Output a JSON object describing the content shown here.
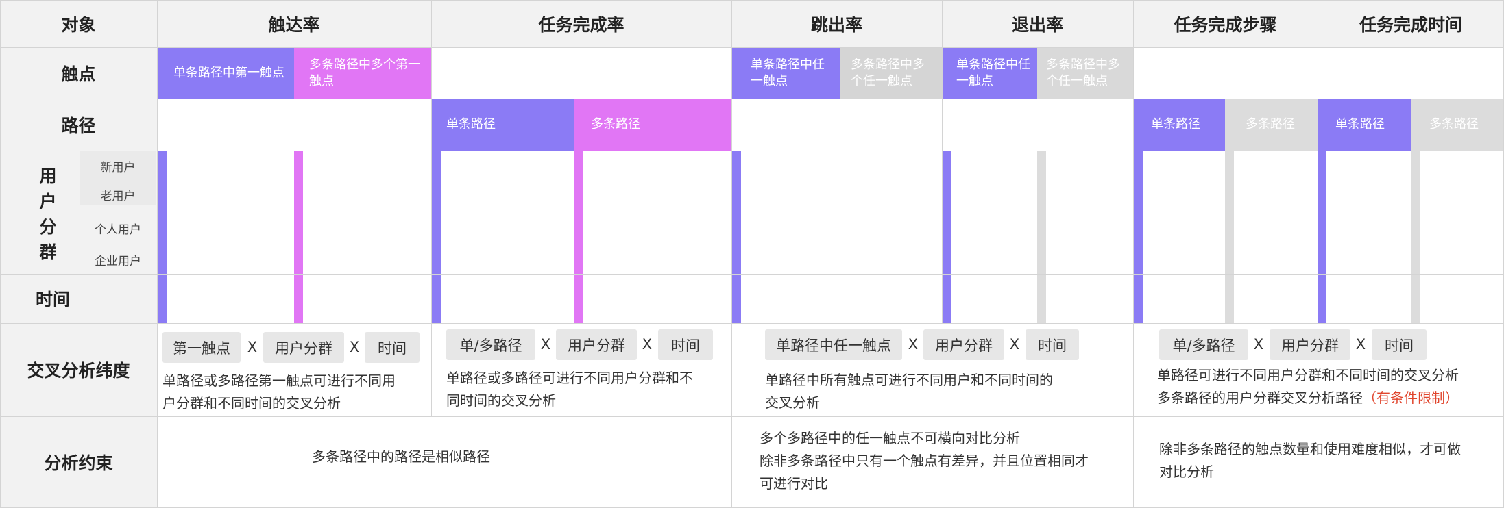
{
  "header": {
    "object": "对象",
    "cols": [
      "触达率",
      "任务完成率",
      "跳出率",
      "退出率",
      "任务完成步骤",
      "任务完成时间"
    ]
  },
  "rows": {
    "touchpoint": "触点",
    "path": "路径",
    "segment_chars": [
      "用",
      "户",
      "分",
      "群"
    ],
    "segment_subs": [
      "新用户",
      "老用户",
      "个人用户",
      "企业用户"
    ],
    "time": "时间",
    "cross": "交叉分析纬度",
    "constraint": "分析约束"
  },
  "chips": {
    "reach_single": "单条路径中第一触点",
    "reach_multi": "多条路径中多个第一触点",
    "bounce_single": "单条路径中任一触点",
    "bounce_multi": "多条路径中多个任一触点",
    "exit_single": "单条路径中任一触点",
    "exit_multi": "多条路径中多个任一触点",
    "task_single": "单条路径",
    "task_multi": "多条路径",
    "steps_single": "单条路径",
    "steps_multi": "多条路径",
    "duration_single": "单条路径",
    "duration_multi": "多条路径"
  },
  "cross": {
    "g1_tags": [
      "第一触点",
      "用户分群",
      "时间"
    ],
    "g1_text": [
      "单路径或多路径第一触点可进行不同用",
      "户分群和不同时间的交叉分析"
    ],
    "g2_tags": [
      "单/多路径",
      "用户分群",
      "时间"
    ],
    "g2_text": [
      "单路径或多路径可进行不同用户分群和不",
      "同时间的交叉分析"
    ],
    "g3_tags": [
      "单路径中任一触点",
      "用户分群",
      "时间"
    ],
    "g3_text": [
      "单路径中所有触点可进行不同用户和不同时间的",
      "交叉分析"
    ],
    "g4_tags": [
      "单/多路径",
      "用户分群",
      "时间"
    ],
    "g4_line1": "单路径可进行不同用户分群和不同时间的交叉分析",
    "g4_line2": "多条路径的用户分群交叉分析路径",
    "g4_line2_red": "（有条件限制）",
    "x": "X"
  },
  "constraints": {
    "c1": "多条路径中的路径是相似路径",
    "c2": [
      "多个多路径中的任一触点不可横向对比分析",
      "除非多条路径中只有一个触点有差异，并且位置相同才",
      "可进行对比"
    ],
    "c3": [
      "除非多条路径的触点数量和使用难度相似，才可做",
      "对比分析"
    ]
  },
  "colors": {
    "purple": "#8b7bf5",
    "pink": "#e176f5",
    "gray": "#d9d9d9",
    "header_bg": "#f2f2f2",
    "red": "#e0452d"
  }
}
